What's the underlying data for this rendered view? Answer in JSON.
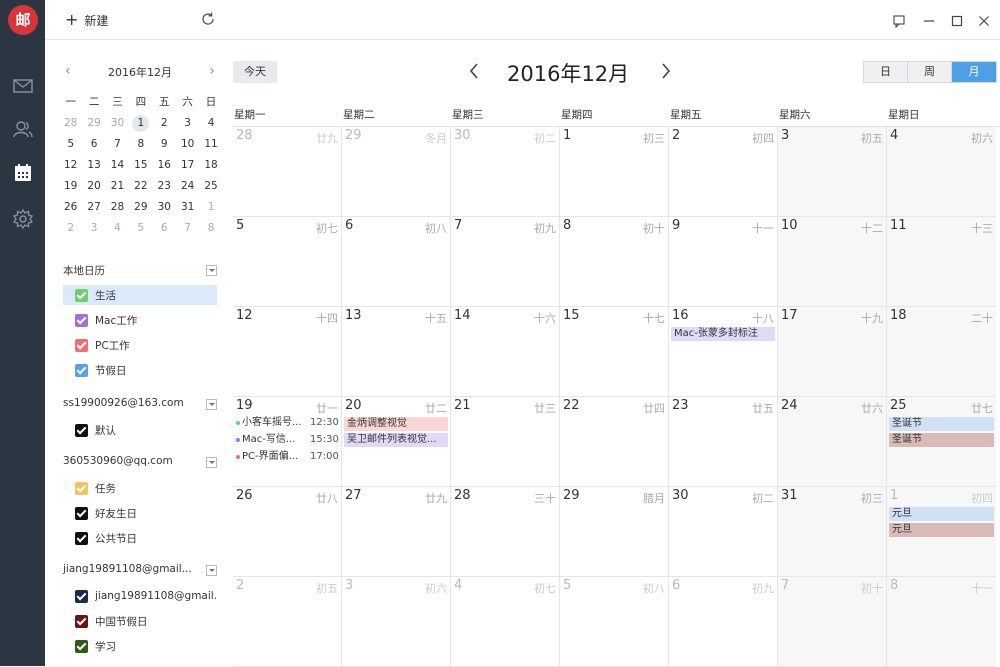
{
  "app": {
    "logo_text": "邮"
  },
  "colors": {
    "rail_bg": "#2c3643",
    "accent": "#4d9fe6",
    "logo": "#d8353b"
  },
  "rail": [
    {
      "name": "mail-icon"
    },
    {
      "name": "contacts-icon"
    },
    {
      "name": "calendar-icon"
    },
    {
      "name": "settings-icon"
    }
  ],
  "toolbar": {
    "new_label": "新建"
  },
  "mini_calendar": {
    "title": "2016年12月",
    "weekdays": [
      "一",
      "二",
      "三",
      "四",
      "五",
      "六",
      "日"
    ],
    "weeks": [
      [
        {
          "d": "28",
          "dim": true
        },
        {
          "d": "29",
          "dim": true
        },
        {
          "d": "30",
          "dim": true
        },
        {
          "d": "1",
          "sel": true
        },
        {
          "d": "2"
        },
        {
          "d": "3"
        },
        {
          "d": "4"
        }
      ],
      [
        {
          "d": "5"
        },
        {
          "d": "6"
        },
        {
          "d": "7"
        },
        {
          "d": "8"
        },
        {
          "d": "9"
        },
        {
          "d": "10"
        },
        {
          "d": "11"
        }
      ],
      [
        {
          "d": "12"
        },
        {
          "d": "13"
        },
        {
          "d": "14"
        },
        {
          "d": "15"
        },
        {
          "d": "16"
        },
        {
          "d": "17"
        },
        {
          "d": "18"
        }
      ],
      [
        {
          "d": "19"
        },
        {
          "d": "20"
        },
        {
          "d": "21"
        },
        {
          "d": "22"
        },
        {
          "d": "23"
        },
        {
          "d": "24"
        },
        {
          "d": "25"
        }
      ],
      [
        {
          "d": "26"
        },
        {
          "d": "27"
        },
        {
          "d": "28"
        },
        {
          "d": "29"
        },
        {
          "d": "30"
        },
        {
          "d": "31"
        },
        {
          "d": "1",
          "dim": true
        }
      ],
      [
        {
          "d": "2",
          "dim": true
        },
        {
          "d": "3",
          "dim": true
        },
        {
          "d": "4",
          "dim": true
        },
        {
          "d": "5",
          "dim": true
        },
        {
          "d": "6",
          "dim": true
        },
        {
          "d": "7",
          "dim": true
        },
        {
          "d": "8",
          "dim": true
        }
      ]
    ]
  },
  "calendar_groups": [
    {
      "title": "本地日历",
      "items": [
        {
          "label": "生活",
          "color": "#6ccf6c",
          "active": true
        },
        {
          "label": "Mac工作",
          "color": "#9b72e0"
        },
        {
          "label": "PC工作",
          "color": "#ee6f6f"
        },
        {
          "label": "节假日",
          "color": "#5aa0e6"
        }
      ]
    },
    {
      "title": "ss19900926@163.com",
      "items": [
        {
          "label": "默认",
          "color": "#111111"
        }
      ]
    },
    {
      "title": "360530960@qq.com",
      "items": [
        {
          "label": "任务",
          "color": "#f2c35e"
        },
        {
          "label": "好友生日",
          "color": "#111111"
        },
        {
          "label": "公共节日",
          "color": "#111111"
        }
      ]
    },
    {
      "title": "jiang19891108@gmail...",
      "items": [
        {
          "label": "jiang19891108@gmail...",
          "color": "#1a2a4a"
        },
        {
          "label": "中国节假日",
          "color": "#6b1414"
        },
        {
          "label": "学习",
          "color": "#2e5a14"
        }
      ]
    }
  ],
  "main": {
    "today_label": "今天",
    "month_title": "2016年12月",
    "views": [
      {
        "label": "日"
      },
      {
        "label": "周"
      },
      {
        "label": "月",
        "on": true
      }
    ],
    "weekday_headers": [
      "星期一",
      "星期二",
      "星期三",
      "星期四",
      "星期五",
      "星期六",
      "星期日"
    ]
  },
  "month_grid": [
    [
      {
        "d": "28",
        "l": "廿九",
        "o": true
      },
      {
        "d": "29",
        "l": "冬月",
        "o": true
      },
      {
        "d": "30",
        "l": "初二",
        "o": true
      },
      {
        "d": "1",
        "l": "初三"
      },
      {
        "d": "2",
        "l": "初四"
      },
      {
        "d": "3",
        "l": "初五"
      },
      {
        "d": "4",
        "l": "初六"
      }
    ],
    [
      {
        "d": "5",
        "l": "初七"
      },
      {
        "d": "6",
        "l": "初八"
      },
      {
        "d": "7",
        "l": "初九"
      },
      {
        "d": "8",
        "l": "初十"
      },
      {
        "d": "9",
        "l": "十一"
      },
      {
        "d": "10",
        "l": "十二"
      },
      {
        "d": "11",
        "l": "十三"
      }
    ],
    [
      {
        "d": "12",
        "l": "十四"
      },
      {
        "d": "13",
        "l": "十五"
      },
      {
        "d": "14",
        "l": "十六"
      },
      {
        "d": "15",
        "l": "十七"
      },
      {
        "d": "16",
        "l": "十八",
        "bars": [
          {
            "text": "Mac-张蒙多封标注",
            "color": "#e2d9f7"
          }
        ]
      },
      {
        "d": "17",
        "l": "十九"
      },
      {
        "d": "18",
        "l": "二十"
      }
    ],
    [
      {
        "d": "19",
        "l": "廿一",
        "lines": [
          {
            "text": "小客车摇号...",
            "time": "12:30",
            "color": "#6ccf6c"
          },
          {
            "text": "Mac-写信...",
            "time": "15:30",
            "color": "#9b72e0"
          },
          {
            "text": "PC-界面偏...",
            "time": "17:00",
            "color": "#ee6f6f"
          }
        ]
      },
      {
        "d": "20",
        "l": "廿二",
        "bars": [
          {
            "text": "金炳调整视觉",
            "color": "#fbd6d6"
          },
          {
            "text": "吴卫邮件列表视觉...",
            "color": "#e2d9f7"
          }
        ]
      },
      {
        "d": "21",
        "l": "廿三"
      },
      {
        "d": "22",
        "l": "廿四"
      },
      {
        "d": "23",
        "l": "廿五"
      },
      {
        "d": "24",
        "l": "廿六"
      },
      {
        "d": "25",
        "l": "廿七",
        "bars": [
          {
            "text": "圣诞节",
            "color": "#cfe1f5"
          },
          {
            "text": "圣诞节",
            "color": "#d9bab8"
          }
        ]
      }
    ],
    [
      {
        "d": "26",
        "l": "廿八"
      },
      {
        "d": "27",
        "l": "廿九"
      },
      {
        "d": "28",
        "l": "三十"
      },
      {
        "d": "29",
        "l": "腊月"
      },
      {
        "d": "30",
        "l": "初二"
      },
      {
        "d": "31",
        "l": "初三"
      },
      {
        "d": "1",
        "l": "初四",
        "o": true,
        "bars": [
          {
            "text": "元旦",
            "color": "#cfe1f5"
          },
          {
            "text": "元旦",
            "color": "#d9bab8"
          }
        ]
      }
    ],
    [
      {
        "d": "2",
        "l": "初五",
        "o": true
      },
      {
        "d": "3",
        "l": "初六",
        "o": true
      },
      {
        "d": "4",
        "l": "初七",
        "o": true
      },
      {
        "d": "5",
        "l": "初八",
        "o": true
      },
      {
        "d": "6",
        "l": "初九",
        "o": true
      },
      {
        "d": "7",
        "l": "初十",
        "o": true
      },
      {
        "d": "8",
        "l": "十一",
        "o": true
      }
    ]
  ]
}
